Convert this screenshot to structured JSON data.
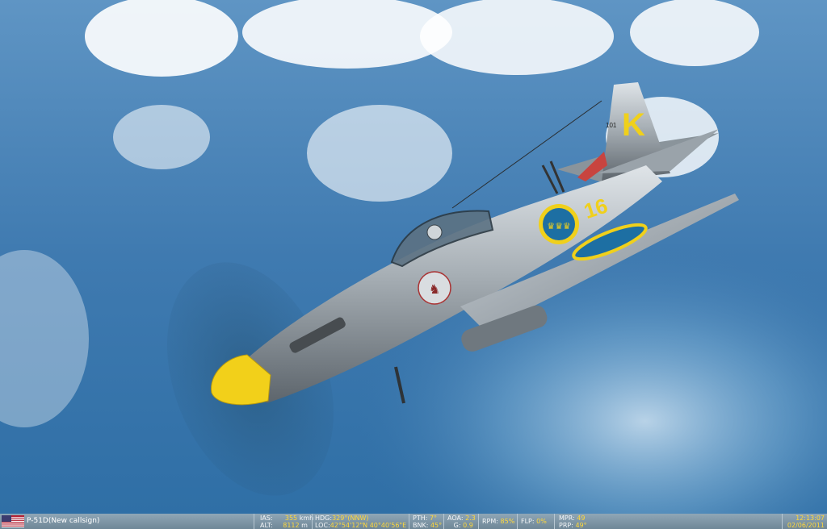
{
  "aircraft": {
    "tail_letter": "K",
    "fuselage_number": "16",
    "tail_serial": "101"
  },
  "hud": {
    "callsign": "P-51D(New callsign)",
    "ias_label": "IAS:",
    "ias_value": "355",
    "ias_unit": "kmh",
    "alt_label": "ALT:",
    "alt_value": "8112",
    "alt_unit": "m",
    "hdg_label": "HDG:",
    "hdg_value": "329°(NNW)",
    "loc_label": "LOC:",
    "loc_value": "42°54'12\"N 40°40'56\"E",
    "pth_label": "PTH:",
    "pth_value": "7°",
    "bnk_label": "BNK:",
    "bnk_value": "45°",
    "aoa_label": "AOA:",
    "aoa_value": "2.3",
    "g_label": "G:",
    "g_value": "0.9",
    "rpm_label": "RPM:",
    "rpm_value": "85%",
    "flp_label": "FLP:",
    "flp_value": "0%",
    "mpr_label": "MPR:",
    "mpr_value": "49",
    "prp_label": "PRP:",
    "prp_value": "49°",
    "time": "12:13:07",
    "date": "02/06/2011"
  },
  "colors": {
    "sky": "#3f7fb6",
    "hud_value": "#ffd83a",
    "spinner": "#f2d01a",
    "roundel_blue": "#1d6fa3",
    "roundel_yellow": "#f0d01b"
  },
  "icons": {
    "flag": "us-flag-icon"
  }
}
